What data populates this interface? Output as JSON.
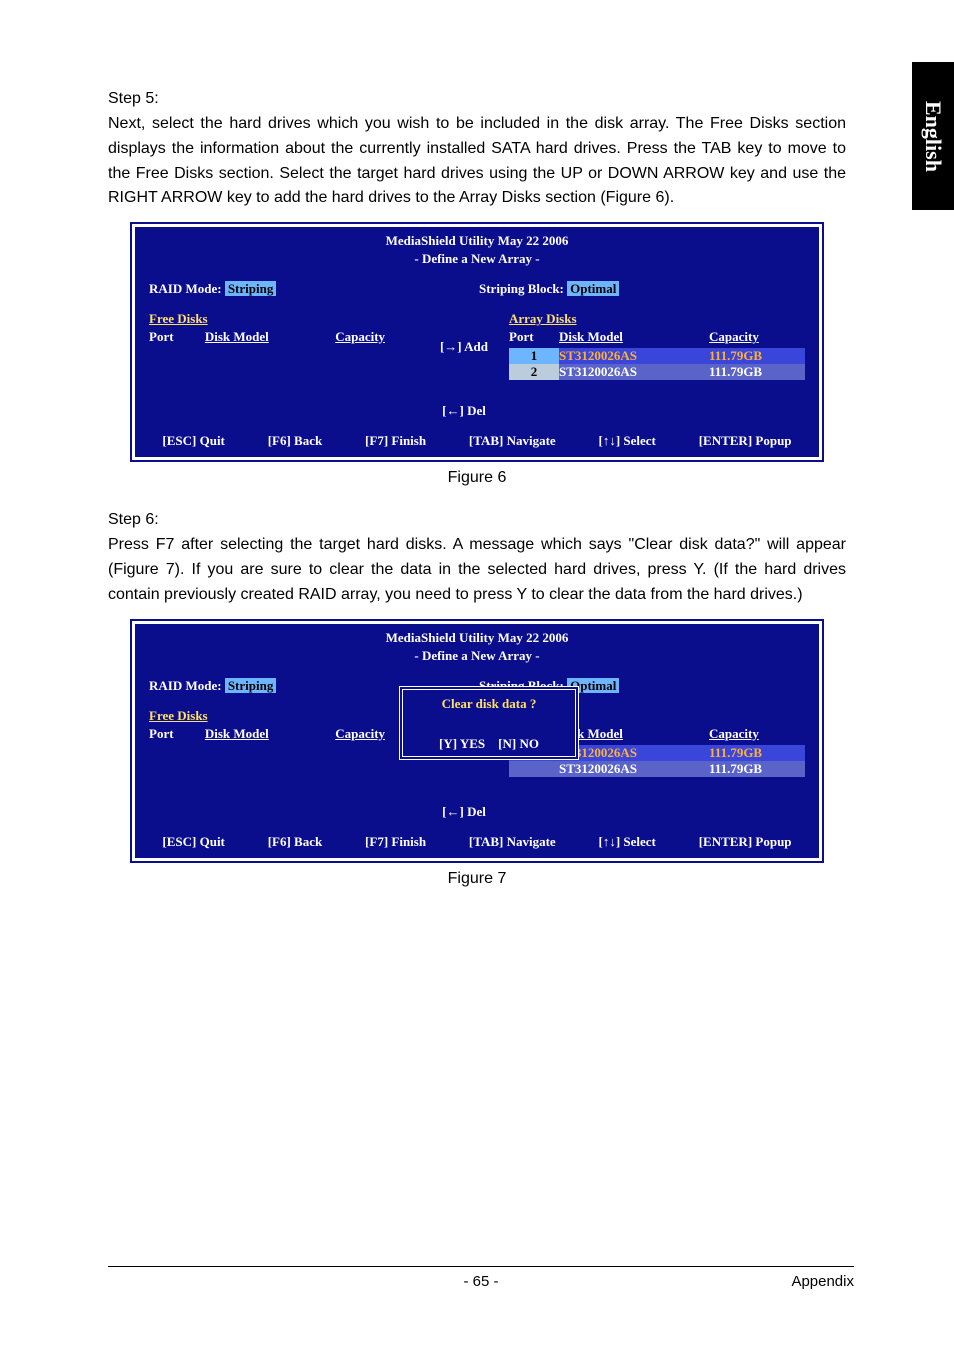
{
  "sidetab": "English",
  "step5": {
    "label": "Step 5:",
    "text": "Next, select the hard drives which you wish to be included in the disk array. The Free Disks section displays the information about the currently installed SATA hard drives. Press the TAB key to move to the Free Disks section. Select the target hard drives using the UP or DOWN ARROW key and use the RIGHT ARROW key to add the hard drives to the Array Disks section (Figure 6)."
  },
  "bios": {
    "title1": "MediaShield Utility  May 22 2006",
    "title2": "- Define a New Array -",
    "raid_mode_label": "RAID Mode:",
    "raid_mode_value": "Striping",
    "striping_block_label": "Striping Block:",
    "striping_block_value": "Optimal",
    "free_disks": "Free Disks",
    "array_disks": "Array Disks",
    "port": "Port",
    "disk_model": "Disk Model",
    "capacity": "Capacity",
    "add": "[→] Add",
    "del": "[←] Del",
    "rows": [
      {
        "port": "1",
        "model": "ST3120026AS",
        "cap": "111.79GB"
      },
      {
        "port": "2",
        "model": "ST3120026AS",
        "cap": "111.79GB"
      }
    ],
    "btnbar": {
      "esc": "[ESC] Quit",
      "f6": "[F6] Back",
      "f7": "[F7] Finish",
      "tab": "[TAB] Navigate",
      "sel": "[↑↓] Select",
      "ent": "[ENTER] Popup"
    }
  },
  "fig6": "Figure 6",
  "step6": {
    "label": "Step 6:",
    "text": "Press F7 after selecting the target hard disks. A message which says \"Clear disk data?\" will appear (Figure 7). If you are sure to clear the data in the selected hard drives, press Y. (If the hard drives contain previously created RAID array, you need to press Y to clear the data from the hard drives.)"
  },
  "dialog": {
    "q": "Clear disk data ?",
    "y": "[Y] YES",
    "n": "[N] NO"
  },
  "fig7": "Figure 7",
  "footer": {
    "page": "- 65 -",
    "section": "Appendix"
  }
}
